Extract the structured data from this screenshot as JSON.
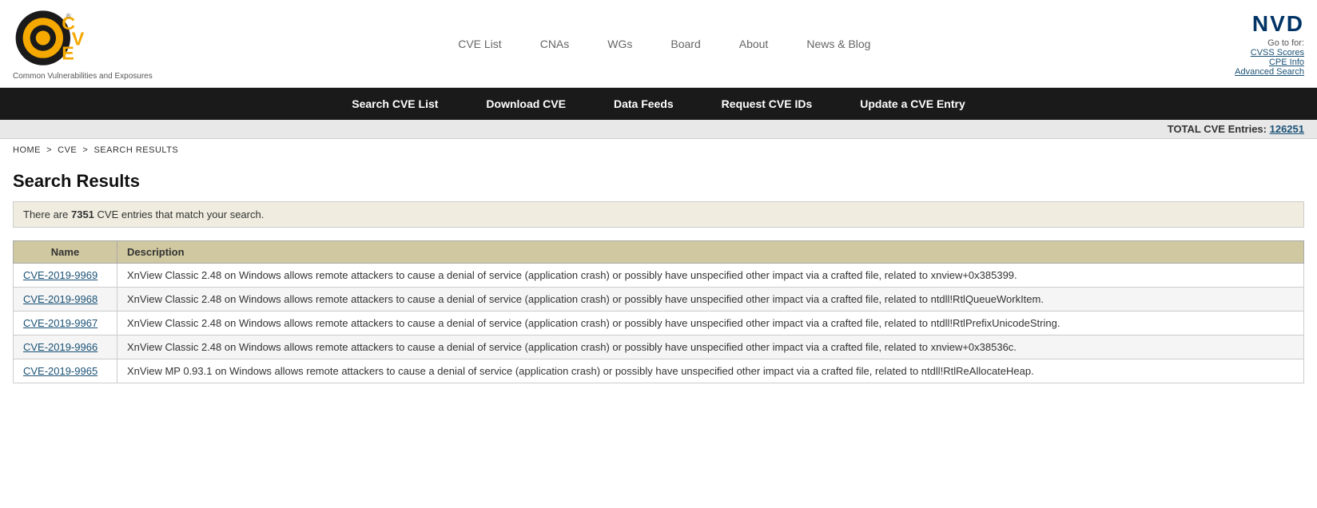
{
  "logo": {
    "tagline": "Common Vulnerabilities and Exposures"
  },
  "top_nav": {
    "items": [
      {
        "label": "CVE List",
        "href": "#"
      },
      {
        "label": "CNAs",
        "href": "#"
      },
      {
        "label": "WGs",
        "href": "#"
      },
      {
        "label": "Board",
        "href": "#"
      },
      {
        "label": "About",
        "href": "#"
      },
      {
        "label": "News & Blog",
        "href": "#"
      }
    ]
  },
  "nvd": {
    "logo": "NVD",
    "goto_label": "Go to for:",
    "links": [
      {
        "label": "CVSS Scores",
        "href": "#"
      },
      {
        "label": "CPE Info",
        "href": "#"
      },
      {
        "label": "Advanced Search",
        "href": "#"
      }
    ]
  },
  "black_toolbar": {
    "items": [
      {
        "label": "Search CVE List",
        "href": "#"
      },
      {
        "label": "Download CVE",
        "href": "#"
      },
      {
        "label": "Data Feeds",
        "href": "#"
      },
      {
        "label": "Request CVE IDs",
        "href": "#"
      },
      {
        "label": "Update a CVE Entry",
        "href": "#"
      }
    ]
  },
  "total_bar": {
    "label": "TOTAL CVE Entries:",
    "count": "126251"
  },
  "breadcrumb": {
    "text": "HOME > CVE > SEARCH RESULTS",
    "home": "HOME",
    "cve": "CVE",
    "results": "SEARCH RESULTS"
  },
  "search_results": {
    "title": "Search Results",
    "info_prefix": "There are ",
    "count": "7351",
    "info_suffix": " CVE entries that match your search.",
    "table": {
      "col_name": "Name",
      "col_desc": "Description",
      "rows": [
        {
          "id": "CVE-2019-9969",
          "description": "XnView Classic 2.48 on Windows allows remote attackers to cause a denial of service (application crash) or possibly have unspecified other impact via a crafted file, related to xnview+0x385399."
        },
        {
          "id": "CVE-2019-9968",
          "description": "XnView Classic 2.48 on Windows allows remote attackers to cause a denial of service (application crash) or possibly have unspecified other impact via a crafted file, related to ntdll!RtlQueueWorkItem."
        },
        {
          "id": "CVE-2019-9967",
          "description": "XnView Classic 2.48 on Windows allows remote attackers to cause a denial of service (application crash) or possibly have unspecified other impact via a crafted file, related to ntdll!RtlPrefixUnicodeString."
        },
        {
          "id": "CVE-2019-9966",
          "description": "XnView Classic 2.48 on Windows allows remote attackers to cause a denial of service (application crash) or possibly have unspecified other impact via a crafted file, related to xnview+0x38536c."
        },
        {
          "id": "CVE-2019-9965",
          "description": "XnView MP 0.93.1 on Windows allows remote attackers to cause a denial of service (application crash) or possibly have unspecified other impact via a crafted file, related to ntdll!RtlReAllocateHeap."
        }
      ]
    }
  }
}
